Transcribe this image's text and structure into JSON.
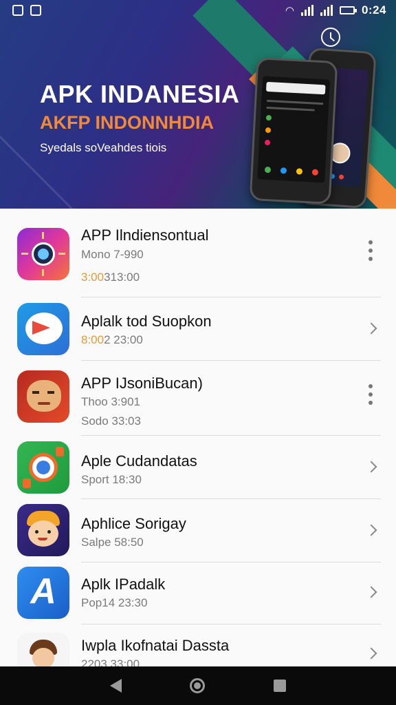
{
  "status_bar": {
    "time": "0:24"
  },
  "hero": {
    "title": "APK INDANESIA",
    "subtitle": "AKFP INDONNHDIA",
    "tagline": "Syedals soVeahdes tiois",
    "phone_text": "no"
  },
  "apps": [
    {
      "name": "APP Ilndiensontual",
      "line1": "Mono 7-990",
      "line2_accent": "3:00",
      "line2_rest": "313:00",
      "action": "kebab",
      "icon": "lens-app-icon"
    },
    {
      "name": "Aplalk tod Suopkon",
      "line1_accent": "8:00",
      "line1_rest": "2 23:00",
      "action": "chevron",
      "icon": "message-bird-app-icon"
    },
    {
      "name": "APP IJsoniBucan)",
      "line1": "Thoo 3:901",
      "line2": "Sodo 33:03",
      "action": "kebab",
      "icon": "cat-face-app-icon"
    },
    {
      "name": "Aple Cudandatas",
      "line1": "Sport 18:30",
      "action": "chevron",
      "icon": "camera-ring-app-icon"
    },
    {
      "name": "Aphlice Sorigay",
      "line1": "Salpe 58:50",
      "action": "chevron",
      "icon": "cartoon-boy-app-icon"
    },
    {
      "name": "Aplk IPadalk",
      "line1": "Pop14 23:30",
      "action": "chevron",
      "icon": "letter-a-app-icon"
    },
    {
      "name": "Iwpla Ikofnatai Dassta",
      "line1": "2203 33:00",
      "action": "chevron",
      "icon": "cartoon-character-app-icon"
    }
  ],
  "colors": {
    "accent_orange": "#f08a3a",
    "hero_blue": "#2d2f86",
    "hero_teal": "#0f5b5a"
  }
}
